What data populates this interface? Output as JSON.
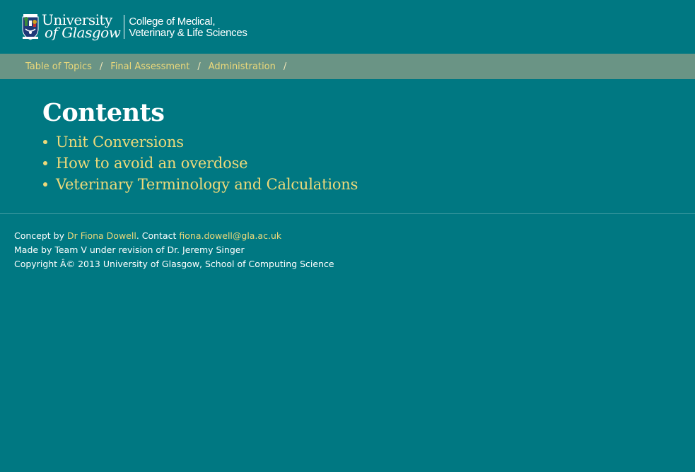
{
  "header": {
    "logo": {
      "university_line1": "University",
      "university_line2": "of Glasgow",
      "college_line1": "College of Medical,",
      "college_line2": "Veterinary & Life Sciences",
      "crest_icon": "university-crest-icon"
    }
  },
  "breadcrumb": {
    "items": [
      {
        "label": "Table of Topics"
      },
      {
        "label": "Final Assessment"
      },
      {
        "label": "Administration"
      }
    ],
    "separator": "/"
  },
  "main": {
    "title": "Contents",
    "topics": [
      {
        "label": "Unit Conversions"
      },
      {
        "label": "How to avoid an overdose"
      },
      {
        "label": "Veterinary Terminology and Calculations"
      }
    ]
  },
  "footer": {
    "concept_prefix": "Concept by ",
    "concept_author": "Dr Fiona Dowell",
    "contact_prefix": ". Contact ",
    "contact_email": "fiona.dowell@gla.ac.uk",
    "made_by": "Made by Team V under revision of Dr. Jeremy Singer",
    "copyright": "Copyright Â© 2013 University of Glasgow, School of Computing Science"
  },
  "colors": {
    "background": "#007882",
    "breadcrumb_bar": "#6a9485",
    "link": "#ecd97a",
    "text": "#ffffff"
  }
}
